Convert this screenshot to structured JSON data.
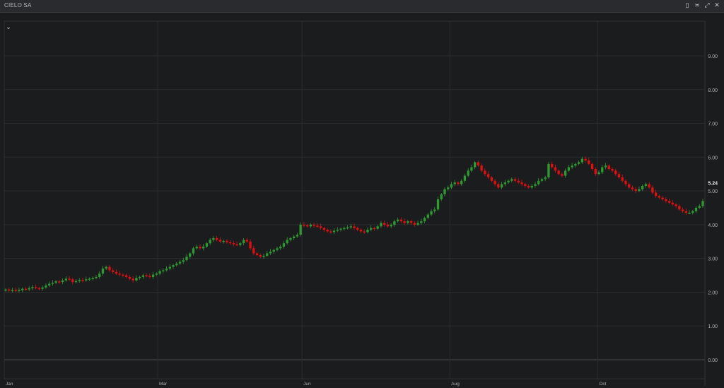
{
  "window": {
    "title": "CIELO SA",
    "icons": [
      "bookmark-icon",
      "settings-icon",
      "expand-icon",
      "close-icon"
    ]
  },
  "chart_data": {
    "type": "candlestick",
    "ylim": [
      0,
      9.8
    ],
    "y_ticks": [
      "0.00",
      "1.00",
      "2.00",
      "3.00",
      "4.00",
      "5.00",
      "6.00",
      "7.00",
      "8.00",
      "9.00"
    ],
    "y_tick_values": [
      0,
      1,
      2,
      3,
      4,
      5,
      6,
      7,
      8,
      9
    ],
    "last_price_label": "5.24",
    "last_price": 5.24,
    "x_ticks": [
      "Jan",
      "Mar",
      "Jun",
      "Aug",
      "Oct"
    ],
    "x_tick_fraction": [
      0.0,
      0.219,
      0.425,
      0.636,
      0.847
    ],
    "grid": true,
    "colors": {
      "up": "#2f9a32",
      "down": "#e01010",
      "grid": "#2b2c30",
      "background": "#1b1c1e"
    },
    "series": [
      {
        "close": [
          2.08,
          2.05,
          2.07,
          2.04,
          2.06,
          2.1,
          2.08,
          2.12,
          2.15,
          2.12,
          2.1,
          2.14,
          2.2,
          2.25,
          2.28,
          2.32,
          2.3,
          2.35,
          2.4,
          2.38,
          2.3,
          2.33,
          2.36,
          2.35,
          2.38,
          2.4,
          2.42,
          2.45,
          2.55,
          2.7,
          2.75,
          2.65,
          2.6,
          2.55,
          2.52,
          2.5,
          2.45,
          2.4,
          2.35,
          2.42,
          2.45,
          2.5,
          2.48,
          2.45,
          2.52,
          2.55,
          2.62,
          2.65,
          2.7,
          2.75,
          2.8,
          2.85,
          2.9,
          2.95,
          3.05,
          3.15,
          3.3,
          3.35,
          3.3,
          3.35,
          3.45,
          3.55,
          3.6,
          3.55,
          3.5,
          3.52,
          3.48,
          3.45,
          3.42,
          3.4,
          3.45,
          3.55,
          3.5,
          3.3,
          3.15,
          3.1,
          3.05,
          3.08,
          3.15,
          3.2,
          3.25,
          3.3,
          3.35,
          3.45,
          3.55,
          3.6,
          3.65,
          3.7,
          4.0,
          3.98,
          3.95,
          4.0,
          3.97,
          3.95,
          3.9,
          3.85,
          3.8,
          3.78,
          3.82,
          3.85,
          3.88,
          3.9,
          3.92,
          3.95,
          3.9,
          3.85,
          3.8,
          3.78,
          3.85,
          3.9,
          3.88,
          3.95,
          4.05,
          4.0,
          3.95,
          4.0,
          4.1,
          4.15,
          4.1,
          4.05,
          4.1,
          4.05,
          4.0,
          4.05,
          4.1,
          4.2,
          4.3,
          4.4,
          4.45,
          4.75,
          4.9,
          5.05,
          5.1,
          5.2,
          5.25,
          5.2,
          5.3,
          5.45,
          5.6,
          5.7,
          5.85,
          5.75,
          5.6,
          5.5,
          5.4,
          5.3,
          5.2,
          5.1,
          5.2,
          5.25,
          5.3,
          5.35,
          5.3,
          5.25,
          5.2,
          5.15,
          5.1,
          5.15,
          5.2,
          5.3,
          5.35,
          5.4,
          5.8,
          5.7,
          5.6,
          5.5,
          5.45,
          5.6,
          5.7,
          5.75,
          5.8,
          5.85,
          5.95,
          5.9,
          5.8,
          5.65,
          5.5,
          5.55,
          5.7,
          5.75,
          5.65,
          5.6,
          5.5,
          5.4,
          5.3,
          5.2,
          5.1,
          5.05,
          5.0,
          5.05,
          5.15,
          5.2,
          5.1,
          4.95,
          4.85,
          4.8,
          4.75,
          4.7,
          4.65,
          4.6,
          4.55,
          4.45,
          4.4,
          4.35,
          4.35,
          4.4,
          4.5,
          4.55,
          4.7
        ]
      }
    ]
  }
}
